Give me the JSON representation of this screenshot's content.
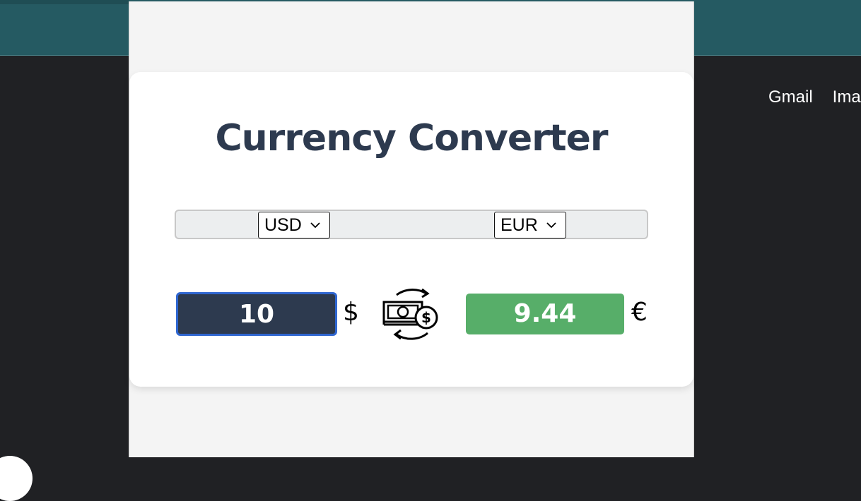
{
  "background_page": {
    "links": [
      "Gmail",
      "Ima"
    ]
  },
  "popup": {
    "title": "Currency Converter",
    "from_currency": {
      "selected": "USD",
      "symbol": "$"
    },
    "to_currency": {
      "selected": "EUR",
      "symbol": "€"
    },
    "amount": "10",
    "result": "9.44",
    "icons": {
      "swap": "money-exchange-icon",
      "dropdown": "chevron-down-icon"
    },
    "colors": {
      "title": "#2d3a4f",
      "amount_bg": "#2d3a4f",
      "amount_border": "#2f66d0",
      "result_bg": "#57ae69"
    }
  }
}
